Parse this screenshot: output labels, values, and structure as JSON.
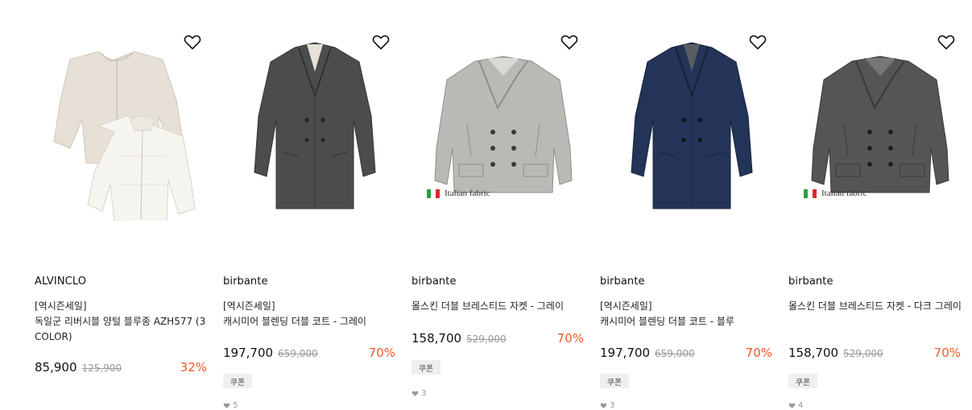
{
  "products": [
    {
      "brand": "ALVINCLO",
      "tag": "[역시즌세일]",
      "name": "독일군 리버시블 양털 블루종 AZH577 (3 COLOR)",
      "price": "85,900",
      "original_price": "125,900",
      "discount": "32%",
      "image": "reversible-fleece-jacket"
    },
    {
      "brand": "birbante",
      "tag": "[역시즌세일]",
      "name": "캐시미어 블렌딩 더블 코트 - 그레이",
      "price": "197,700",
      "original_price": "659,000",
      "discount": "70%",
      "coupon": "쿠폰",
      "likes": "5",
      "image": "charcoal-double-coat"
    },
    {
      "brand": "birbante",
      "name": "몰스킨 더블 브레스티드 자켓 - 그레이",
      "price": "158,700",
      "original_price": "529,000",
      "discount": "70%",
      "coupon": "쿠폰",
      "likes": "3",
      "fabric_label": "Italian fabric",
      "image": "light-grey-peacoat"
    },
    {
      "brand": "birbante",
      "tag": "[역시즌세일]",
      "name": "캐시미어 블렌딩 더블 코트 - 블루",
      "price": "197,700",
      "original_price": "659,000",
      "discount": "70%",
      "coupon": "쿠폰",
      "likes": "3",
      "image": "navy-double-coat"
    },
    {
      "brand": "birbante",
      "name": "몰스킨 더블 브레스티드 자켓 - 다크 그레이",
      "price": "158,700",
      "original_price": "529,000",
      "discount": "70%",
      "coupon": "쿠폰",
      "likes": "4",
      "fabric_label": "Italian fabric",
      "image": "dark-grey-peacoat"
    }
  ],
  "icons": {
    "wishlist": "heart-outline-icon",
    "like_count": "heart-filled-icon"
  },
  "colors": {
    "discount": "#f05a28",
    "coupon_bg": "#efefef",
    "flag_green": "#2e9e3e",
    "flag_red": "#d62b2b"
  }
}
